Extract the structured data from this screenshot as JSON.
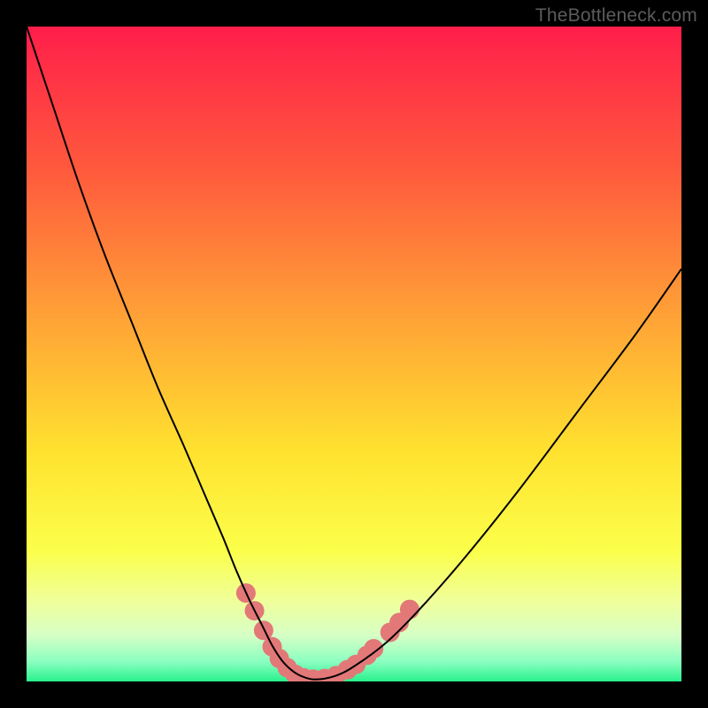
{
  "watermark": "TheBottleneck.com",
  "chart_data": {
    "type": "line",
    "title": "",
    "xlabel": "",
    "ylabel": "",
    "xlim": [
      0,
      100
    ],
    "ylim": [
      0,
      100
    ],
    "grid": false,
    "legend": false,
    "background_gradient": {
      "stops": [
        {
          "pct": 0,
          "color": "#ff1e4a"
        },
        {
          "pct": 22,
          "color": "#ff5a3d"
        },
        {
          "pct": 45,
          "color": "#ffa436"
        },
        {
          "pct": 65,
          "color": "#ffe22f"
        },
        {
          "pct": 80,
          "color": "#fbff4a"
        },
        {
          "pct": 88,
          "color": "#efff9d"
        },
        {
          "pct": 93,
          "color": "#d6ffc6"
        },
        {
          "pct": 97,
          "color": "#8affc0"
        },
        {
          "pct": 100,
          "color": "#29f18d"
        }
      ]
    },
    "series": [
      {
        "name": "bottleneck-curve",
        "color": "#000000",
        "width": 2,
        "x": [
          0,
          4,
          8,
          12,
          16,
          20,
          24,
          27,
          30,
          32,
          34,
          36,
          37.5,
          39,
          40.5,
          42,
          44,
          47,
          50,
          55,
          60,
          67,
          75,
          84,
          93,
          100
        ],
        "y": [
          100,
          88,
          76,
          65,
          55,
          45,
          36,
          29,
          22,
          17,
          12.5,
          8.5,
          5.5,
          3.2,
          1.7,
          0.8,
          0.3,
          0.8,
          2.3,
          6.0,
          11,
          19,
          29,
          41,
          53,
          63
        ]
      }
    ],
    "markers": {
      "name": "highlight-dots",
      "color": "#e27878",
      "radius": 11,
      "points": [
        {
          "x": 33.5,
          "y": 13.5
        },
        {
          "x": 34.8,
          "y": 10.8
        },
        {
          "x": 36.2,
          "y": 7.8
        },
        {
          "x": 37.5,
          "y": 5.3
        },
        {
          "x": 38.6,
          "y": 3.5
        },
        {
          "x": 39.8,
          "y": 2.1
        },
        {
          "x": 41.0,
          "y": 1.1
        },
        {
          "x": 42.3,
          "y": 0.55
        },
        {
          "x": 43.8,
          "y": 0.35
        },
        {
          "x": 45.5,
          "y": 0.45
        },
        {
          "x": 47.3,
          "y": 0.9
        },
        {
          "x": 49.0,
          "y": 1.8
        },
        {
          "x": 50.3,
          "y": 2.6
        },
        {
          "x": 52.0,
          "y": 4.0
        },
        {
          "x": 53.0,
          "y": 5.0
        },
        {
          "x": 55.5,
          "y": 7.5
        },
        {
          "x": 56.9,
          "y": 9.0
        },
        {
          "x": 58.5,
          "y": 11.0
        }
      ]
    }
  }
}
